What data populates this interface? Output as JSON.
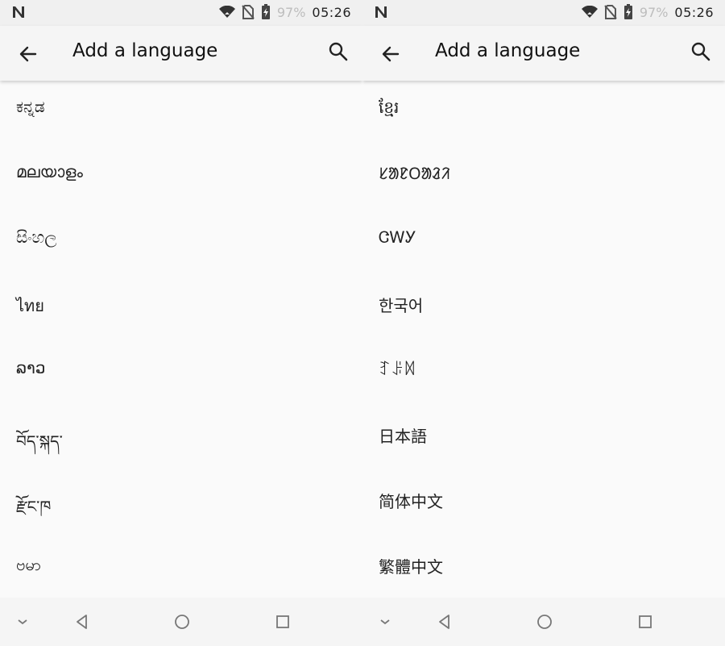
{
  "status": {
    "notification_icon": "n-icon",
    "battery_percent": "97%",
    "time": "05:26"
  },
  "appbar": {
    "title": "Add a language"
  },
  "left": {
    "items": [
      "ಕನ್ನಡ",
      "മലയാളം",
      "සිංහල",
      "ไทย",
      "ລາວ",
      "བོད་སྐད་",
      "རྫོང་ཁ",
      "ဗမာ"
    ]
  },
  "right": {
    "items": [
      "ខ្មែរ",
      "ᱥᱟᱱᱛᱟᱲᱤ",
      "ᏣᎳᎩ",
      "한국어",
      "ꆈꌠꉙ",
      "日本語",
      "简体中文",
      "繁體中文"
    ]
  },
  "colors": {
    "appbar": "#f5f5f5",
    "background": "#fafafa",
    "divider": "#e0e0e0",
    "text": "#222222"
  }
}
